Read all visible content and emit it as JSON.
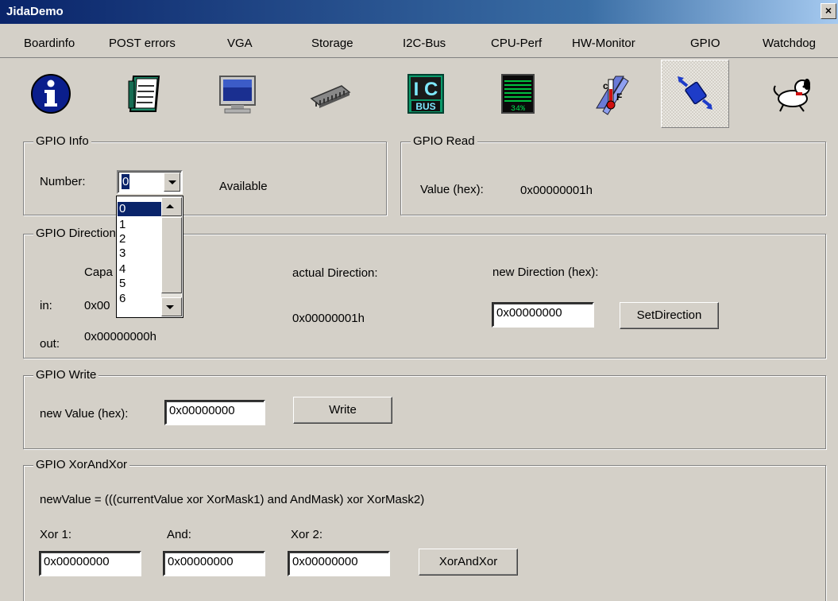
{
  "window": {
    "title": "JidaDemo",
    "close_label": "×"
  },
  "tabs": [
    "Boardinfo",
    "POST errors",
    "VGA",
    "Storage",
    "I2C-Bus",
    "CPU-Perf",
    "HW-Monitor",
    "GPIO",
    "Watchdog"
  ],
  "tab_icons": [
    "info-icon",
    "notepad-icon",
    "monitor-icon",
    "memory-chip-icon",
    "i2c-bus-icon",
    "cpu-perf-icon",
    "thermometer-icon",
    "gpio-icon",
    "watchdog-dog-icon"
  ],
  "active_tab": "GPIO",
  "i2c_icon_text": {
    "top": "I C",
    "bottom": "BUS"
  },
  "cpu_icon_text": "34%",
  "gpio_info": {
    "title": "GPIO Info",
    "number_label": "Number:",
    "number_value": "0",
    "status": "Available",
    "dropdown_options": [
      "0",
      "1",
      "2",
      "3",
      "4",
      "5",
      "6"
    ]
  },
  "gpio_read": {
    "title": "GPIO Read",
    "value_label": "Value (hex):",
    "value": "0x00000001h"
  },
  "gpio_direction": {
    "title": "GPIO Direction",
    "capabilities_label": "Capa",
    "in_label": "in:",
    "in_value": "0x00",
    "out_label": "out:",
    "out_value": "0x00000000h",
    "actual_label": "actual Direction:",
    "actual_value": "0x00000001h",
    "new_label": "new Direction (hex):",
    "new_value": "0x00000000",
    "set_button": "SetDirection"
  },
  "gpio_write": {
    "title": "GPIO Write",
    "label": "new Value (hex):",
    "value": "0x00000000",
    "button": "Write"
  },
  "gpio_xor": {
    "title": "GPIO XorAndXor",
    "formula": "newValue = (((currentValue xor XorMask1) and AndMask) xor XorMask2)",
    "xor1_label": "Xor 1:",
    "and_label": "And:",
    "xor2_label": "Xor 2:",
    "xor1_value": "0x00000000",
    "and_value": "0x00000000",
    "xor2_value": "0x00000000",
    "button": "XorAndXor"
  }
}
